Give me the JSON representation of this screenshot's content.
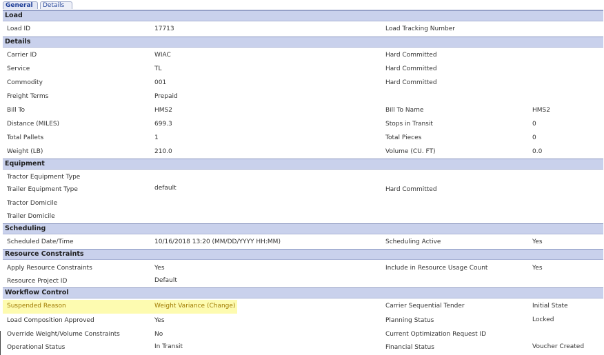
{
  "tabs": {
    "general": "General",
    "details": "Details"
  },
  "sections": {
    "load": "Load",
    "details": "Details",
    "equipment": "Equipment",
    "scheduling": "Scheduling",
    "resource_constraints": "Resource Constraints",
    "workflow_control": "Workflow Control"
  },
  "load": {
    "load_id_label": "Load ID",
    "load_id_value": "17713",
    "tracking_label": "Load Tracking Number",
    "tracking_value": ""
  },
  "details": {
    "carrier_id_label": "Carrier ID",
    "carrier_id_value": "WIAC",
    "carrier_id_status": "Hard Committed",
    "service_label": "Service",
    "service_value": "TL",
    "service_status": "Hard Committed",
    "commodity_label": "Commodity",
    "commodity_value": "001",
    "commodity_status": "Hard Committed",
    "freight_terms_label": "Freight Terms",
    "freight_terms_value": "Prepaid",
    "bill_to_label": "Bill To",
    "bill_to_value": "HMS2",
    "bill_to_name_label": "Bill To Name",
    "bill_to_name_value": "HMS2",
    "distance_label": "Distance (MILES)",
    "distance_value": "699.3",
    "stops_label": "Stops in Transit",
    "stops_value": "0",
    "pallets_label": "Total Pallets",
    "pallets_value": "1",
    "pieces_label": "Total Pieces",
    "pieces_value": "0",
    "weight_label": "Weight (LB)",
    "weight_value": "210.0",
    "volume_label": "Volume (CU. FT)",
    "volume_value": "0.0"
  },
  "equipment": {
    "tractor_type_label": "Tractor Equipment Type",
    "trailer_type_label": "Trailer Equipment Type",
    "trailer_type_value": "default",
    "trailer_type_status": "Hard Committed",
    "tractor_domicile_label": "Tractor Domicile",
    "trailer_domicile_label": "Trailer Domicile"
  },
  "scheduling": {
    "scheduled_label": "Scheduled Date/Time",
    "scheduled_value": "10/16/2018 13:20 (MM/DD/YYYY HH:MM)",
    "active_label": "Scheduling Active",
    "active_value": "Yes"
  },
  "resource": {
    "apply_label": "Apply Resource Constraints",
    "apply_value": "Yes",
    "include_label": "Include in Resource Usage Count",
    "include_value": "Yes",
    "project_label": "Resource Project ID",
    "project_value": "Default"
  },
  "workflow": {
    "suspended_label": "Suspended Reason",
    "suspended_value": "Weight Variance (Change)",
    "carrier_tender_label": "Carrier Sequential Tender",
    "carrier_tender_value": "Initial State",
    "composition_label": "Load Composition Approved",
    "composition_value": "Yes",
    "planning_label": "Planning Status",
    "planning_value": "Locked",
    "override_label": "Override Weight/Volume Constraints",
    "override_value": "No",
    "optimization_label": "Current Optimization Request ID",
    "optimization_value": "",
    "operational_label": "Operational Status",
    "operational_value": "In Transit",
    "financial_label": "Financial Status",
    "financial_value": "Voucher Created"
  },
  "colors": {
    "section_header": "#c9d1ec",
    "highlight": "#fdfbb0",
    "tab_text": "#1f3f97"
  }
}
